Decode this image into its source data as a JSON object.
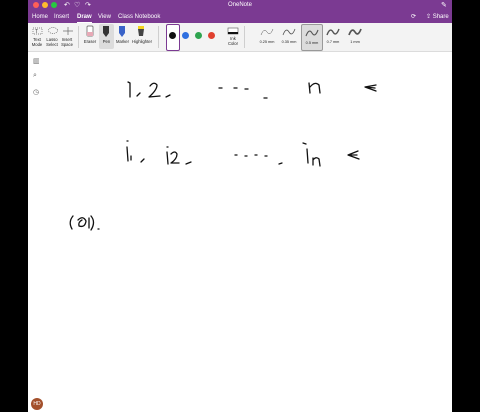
{
  "window": {
    "title": "OneNote"
  },
  "tabs": [
    "Home",
    "Insert",
    "Draw",
    "View",
    "Class Notebook"
  ],
  "share_label": "Share",
  "tools": {
    "text_mode": "Text\nMode",
    "lasso_select": "Lasso\nSelect",
    "insert_space": "Insert\nSpace"
  },
  "pens": {
    "eraser": "Eraser",
    "pen": "Pen",
    "marker": "Marker",
    "highlighter": "Highlighter"
  },
  "ink_color": "Ink\nColor",
  "colors": [
    "#111111",
    "#2f6fe0",
    "#2fa44f",
    "#e0402f"
  ],
  "thickness": [
    "0.25 mm",
    "0.35 mm",
    "0.5 mm",
    "0.7 mm",
    "1 mm"
  ],
  "avatar": "HD",
  "accent": "#7b3a92"
}
